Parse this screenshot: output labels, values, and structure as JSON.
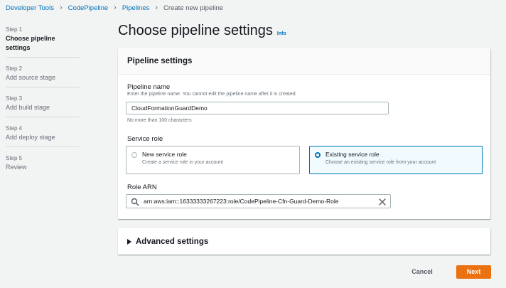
{
  "breadcrumb": {
    "items": [
      "Developer Tools",
      "CodePipeline",
      "Pipelines",
      "Create new pipeline"
    ]
  },
  "steps": [
    {
      "num": "Step 1",
      "title": "Choose pipeline settings",
      "active": true
    },
    {
      "num": "Step 2",
      "title": "Add source stage"
    },
    {
      "num": "Step 3",
      "title": "Add build stage"
    },
    {
      "num": "Step 4",
      "title": "Add deploy stage"
    },
    {
      "num": "Step 5",
      "title": "Review"
    }
  ],
  "page": {
    "title": "Choose pipeline settings",
    "info_label": "Info"
  },
  "pipeline_settings": {
    "header": "Pipeline settings",
    "name_label": "Pipeline name",
    "name_description": "Enter the pipeline name. You cannot edit the pipeline name after it is created.",
    "name_value": "CloudFormationGuardDemo",
    "name_constraint": "No more than 100 characters",
    "service_role_label": "Service role",
    "options": [
      {
        "title": "New service role",
        "description": "Create a service role in your account",
        "selected": false
      },
      {
        "title": "Existing service role",
        "description": "Choose an existing service role from your account",
        "selected": true
      }
    ],
    "role_arn_label": "Role ARN",
    "role_arn_value": "arn:aws:iam::16333333267223:role/CodePipeline-Cfn-Guard-Demo-Role"
  },
  "advanced": {
    "label": "Advanced settings"
  },
  "actions": {
    "cancel_label": "Cancel",
    "next_label": "Next"
  },
  "colors": {
    "link": "#0073bb",
    "primary_button": "#ec7211",
    "selected_border": "#0073bb",
    "selected_bg": "#f1faff"
  }
}
